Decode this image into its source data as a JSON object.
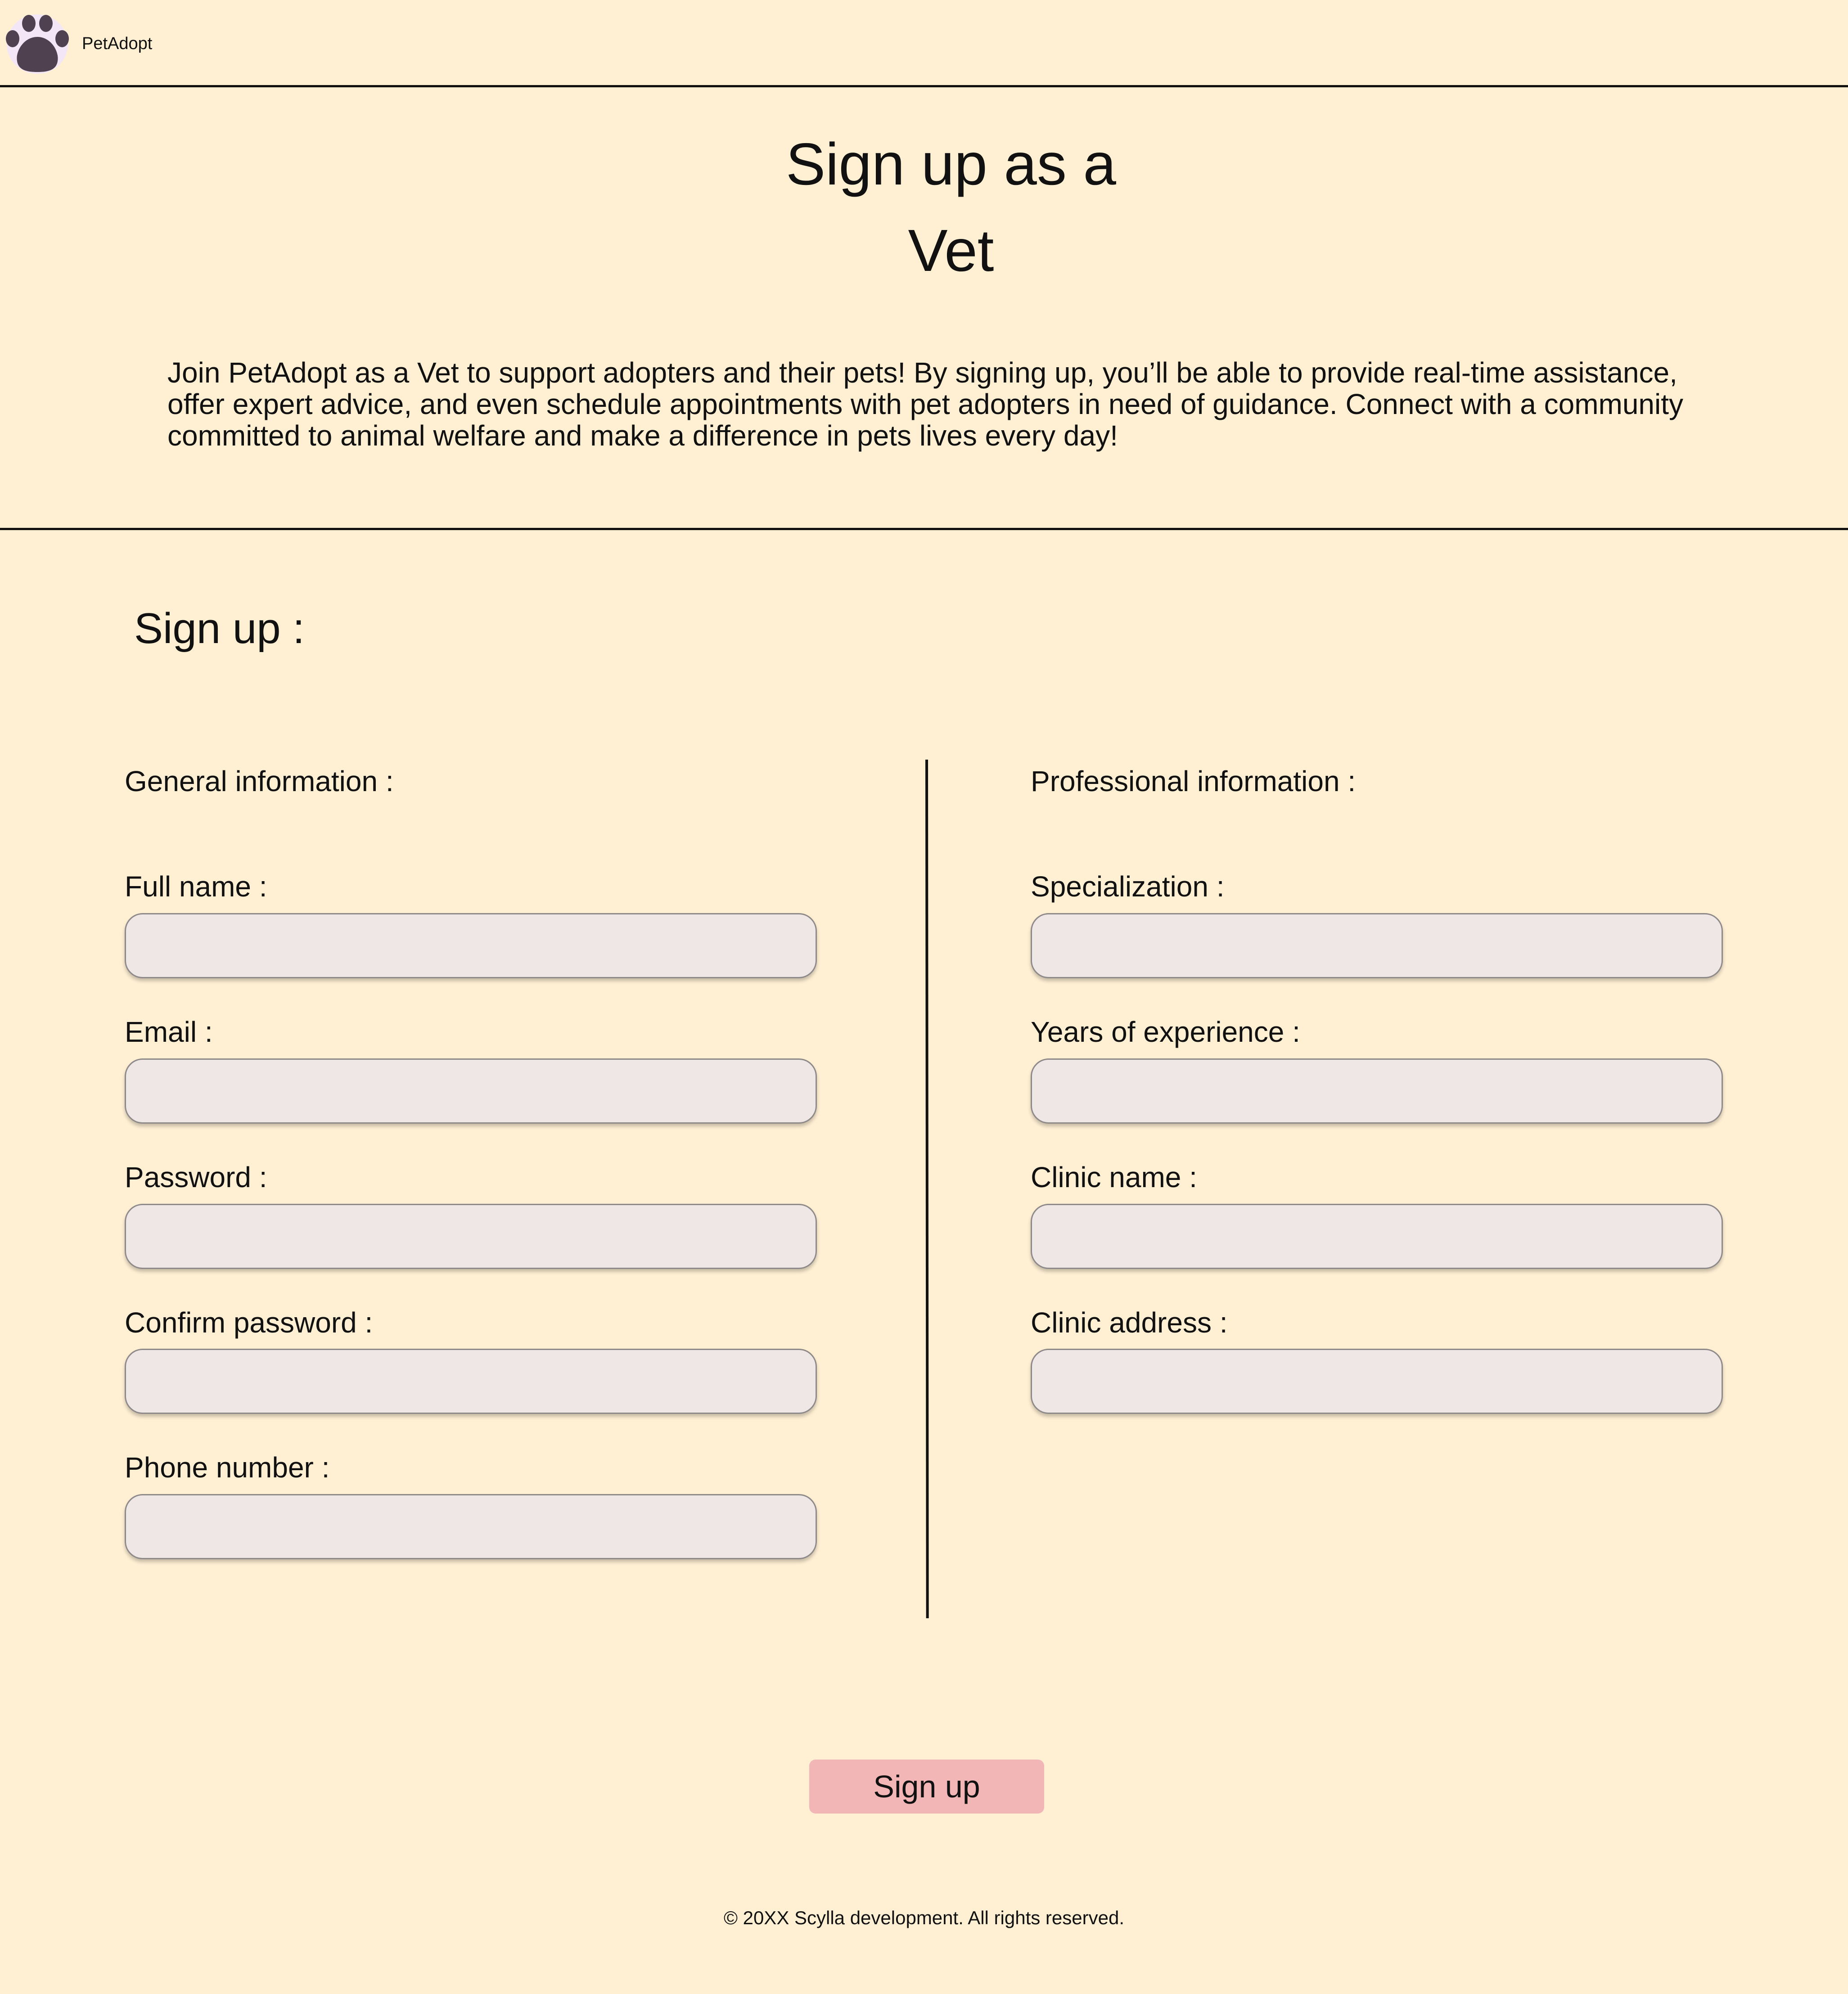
{
  "header": {
    "brand_name": "PetAdopt",
    "logo_icon": "paw-print-icon"
  },
  "hero": {
    "title": "Sign up as a Vet",
    "description": "Join PetAdopt as a Vet to support adopters and their pets! By signing up, you’ll be able to provide real-time assistance, offer expert advice, and even schedule appointments with pet adopters in need of guidance. Connect with a community committed to animal welfare and make a difference in pets lives every day!"
  },
  "form": {
    "title": "Sign up :",
    "general": {
      "heading": "General information :",
      "fields": [
        {
          "label": "Full name :",
          "value": ""
        },
        {
          "label": "Email :",
          "value": ""
        },
        {
          "label": "Password :",
          "value": ""
        },
        {
          "label": "Confirm password :",
          "value": ""
        },
        {
          "label": "Phone number :",
          "value": ""
        }
      ]
    },
    "professional": {
      "heading": "Professional information :",
      "fields": [
        {
          "label": "Specialization :",
          "value": ""
        },
        {
          "label": "Years of experience :",
          "value": ""
        },
        {
          "label": "Clinic name :",
          "value": ""
        },
        {
          "label": "Clinic address :",
          "value": ""
        }
      ]
    },
    "submit_label": "Sign up"
  },
  "footer": {
    "copyright": "© 20XX Scylla development. All rights reserved."
  },
  "colors": {
    "background": "#fff0d4",
    "input_fill": "#efe6e6",
    "button_fill": "#f2b6b6",
    "logo_fill": "#4f4150",
    "rule": "#111111"
  }
}
